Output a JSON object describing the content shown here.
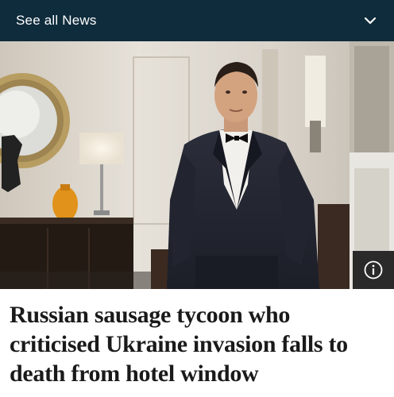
{
  "topbar": {
    "label": "See all News",
    "expand_icon": "chevron-down-icon",
    "background": "#0f2c3c"
  },
  "hero": {
    "info_icon": "info-icon"
  },
  "article": {
    "headline": "Russian sausage tycoon who criticised Ukraine invasion falls to death from hotel window"
  }
}
